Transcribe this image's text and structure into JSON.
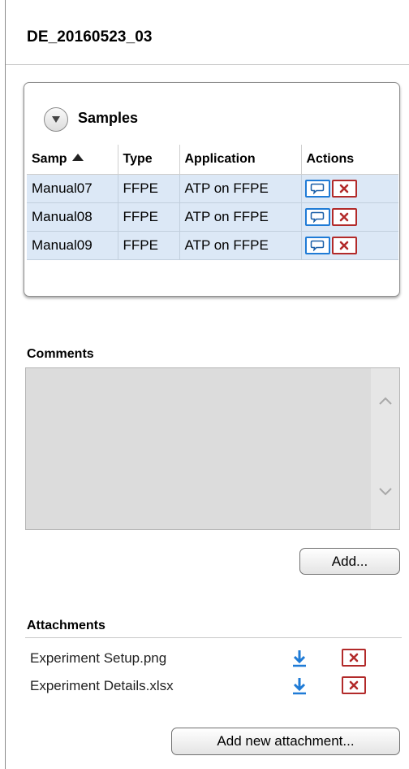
{
  "experiment": {
    "title": "DE_20160523_03"
  },
  "samples": {
    "title": "Samples",
    "columns": [
      "Samp",
      "Type",
      "Application",
      "Actions"
    ],
    "rows": [
      {
        "sample": "Manual07",
        "type": "FFPE",
        "application": "ATP on FFPE"
      },
      {
        "sample": "Manual08",
        "type": "FFPE",
        "application": "ATP on FFPE"
      },
      {
        "sample": "Manual09",
        "type": "FFPE",
        "application": "ATP on FFPE"
      }
    ]
  },
  "comments": {
    "label": "Comments",
    "value": "",
    "add_label": "Add..."
  },
  "attachments": {
    "label": "Attachments",
    "items": [
      {
        "name": "Experiment Setup.png"
      },
      {
        "name": "Experiment Details.xlsx"
      }
    ],
    "add_label": "Add new attachment..."
  },
  "icons": {
    "collapse": "chevron-down-circle-icon",
    "sort": "sort-ascending-icon",
    "comment": "speech-bubble-icon",
    "delete": "close-x-icon",
    "download": "download-arrow-icon",
    "scroll_left": "chevron-left-icon",
    "scroll_right": "chevron-right-icon",
    "scroll_up": "chevron-up-icon",
    "scroll_down": "chevron-down-icon"
  },
  "colors": {
    "row_highlight": "#dce8f6",
    "action_blue": "#1f7bd6",
    "delete_red": "#b22a2a"
  }
}
